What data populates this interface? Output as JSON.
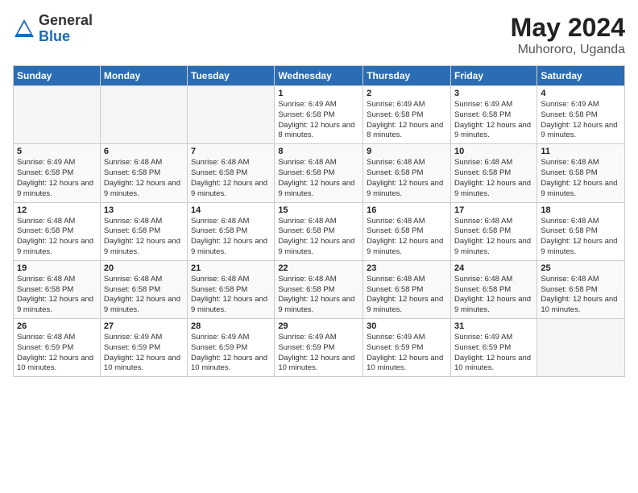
{
  "logo": {
    "general": "General",
    "blue": "Blue"
  },
  "header": {
    "month": "May 2024",
    "location": "Muhororo, Uganda"
  },
  "weekdays": [
    "Sunday",
    "Monday",
    "Tuesday",
    "Wednesday",
    "Thursday",
    "Friday",
    "Saturday"
  ],
  "weeks": [
    [
      {
        "day": "",
        "info": ""
      },
      {
        "day": "",
        "info": ""
      },
      {
        "day": "",
        "info": ""
      },
      {
        "day": "1",
        "info": "Sunrise: 6:49 AM\nSunset: 6:58 PM\nDaylight: 12 hours\nand 8 minutes."
      },
      {
        "day": "2",
        "info": "Sunrise: 6:49 AM\nSunset: 6:58 PM\nDaylight: 12 hours\nand 8 minutes."
      },
      {
        "day": "3",
        "info": "Sunrise: 6:49 AM\nSunset: 6:58 PM\nDaylight: 12 hours\nand 9 minutes."
      },
      {
        "day": "4",
        "info": "Sunrise: 6:49 AM\nSunset: 6:58 PM\nDaylight: 12 hours\nand 9 minutes."
      }
    ],
    [
      {
        "day": "5",
        "info": "Sunrise: 6:49 AM\nSunset: 6:58 PM\nDaylight: 12 hours\nand 9 minutes."
      },
      {
        "day": "6",
        "info": "Sunrise: 6:48 AM\nSunset: 6:58 PM\nDaylight: 12 hours\nand 9 minutes."
      },
      {
        "day": "7",
        "info": "Sunrise: 6:48 AM\nSunset: 6:58 PM\nDaylight: 12 hours\nand 9 minutes."
      },
      {
        "day": "8",
        "info": "Sunrise: 6:48 AM\nSunset: 6:58 PM\nDaylight: 12 hours\nand 9 minutes."
      },
      {
        "day": "9",
        "info": "Sunrise: 6:48 AM\nSunset: 6:58 PM\nDaylight: 12 hours\nand 9 minutes."
      },
      {
        "day": "10",
        "info": "Sunrise: 6:48 AM\nSunset: 6:58 PM\nDaylight: 12 hours\nand 9 minutes."
      },
      {
        "day": "11",
        "info": "Sunrise: 6:48 AM\nSunset: 6:58 PM\nDaylight: 12 hours\nand 9 minutes."
      }
    ],
    [
      {
        "day": "12",
        "info": "Sunrise: 6:48 AM\nSunset: 6:58 PM\nDaylight: 12 hours\nand 9 minutes."
      },
      {
        "day": "13",
        "info": "Sunrise: 6:48 AM\nSunset: 6:58 PM\nDaylight: 12 hours\nand 9 minutes."
      },
      {
        "day": "14",
        "info": "Sunrise: 6:48 AM\nSunset: 6:58 PM\nDaylight: 12 hours\nand 9 minutes."
      },
      {
        "day": "15",
        "info": "Sunrise: 6:48 AM\nSunset: 6:58 PM\nDaylight: 12 hours\nand 9 minutes."
      },
      {
        "day": "16",
        "info": "Sunrise: 6:48 AM\nSunset: 6:58 PM\nDaylight: 12 hours\nand 9 minutes."
      },
      {
        "day": "17",
        "info": "Sunrise: 6:48 AM\nSunset: 6:58 PM\nDaylight: 12 hours\nand 9 minutes."
      },
      {
        "day": "18",
        "info": "Sunrise: 6:48 AM\nSunset: 6:58 PM\nDaylight: 12 hours\nand 9 minutes."
      }
    ],
    [
      {
        "day": "19",
        "info": "Sunrise: 6:48 AM\nSunset: 6:58 PM\nDaylight: 12 hours\nand 9 minutes."
      },
      {
        "day": "20",
        "info": "Sunrise: 6:48 AM\nSunset: 6:58 PM\nDaylight: 12 hours\nand 9 minutes."
      },
      {
        "day": "21",
        "info": "Sunrise: 6:48 AM\nSunset: 6:58 PM\nDaylight: 12 hours\nand 9 minutes."
      },
      {
        "day": "22",
        "info": "Sunrise: 6:48 AM\nSunset: 6:58 PM\nDaylight: 12 hours\nand 9 minutes."
      },
      {
        "day": "23",
        "info": "Sunrise: 6:48 AM\nSunset: 6:58 PM\nDaylight: 12 hours\nand 9 minutes."
      },
      {
        "day": "24",
        "info": "Sunrise: 6:48 AM\nSunset: 6:58 PM\nDaylight: 12 hours\nand 9 minutes."
      },
      {
        "day": "25",
        "info": "Sunrise: 6:48 AM\nSunset: 6:58 PM\nDaylight: 12 hours\nand 10 minutes."
      }
    ],
    [
      {
        "day": "26",
        "info": "Sunrise: 6:48 AM\nSunset: 6:59 PM\nDaylight: 12 hours\nand 10 minutes."
      },
      {
        "day": "27",
        "info": "Sunrise: 6:49 AM\nSunset: 6:59 PM\nDaylight: 12 hours\nand 10 minutes."
      },
      {
        "day": "28",
        "info": "Sunrise: 6:49 AM\nSunset: 6:59 PM\nDaylight: 12 hours\nand 10 minutes."
      },
      {
        "day": "29",
        "info": "Sunrise: 6:49 AM\nSunset: 6:59 PM\nDaylight: 12 hours\nand 10 minutes."
      },
      {
        "day": "30",
        "info": "Sunrise: 6:49 AM\nSunset: 6:59 PM\nDaylight: 12 hours\nand 10 minutes."
      },
      {
        "day": "31",
        "info": "Sunrise: 6:49 AM\nSunset: 6:59 PM\nDaylight: 12 hours\nand 10 minutes."
      },
      {
        "day": "",
        "info": ""
      }
    ]
  ]
}
